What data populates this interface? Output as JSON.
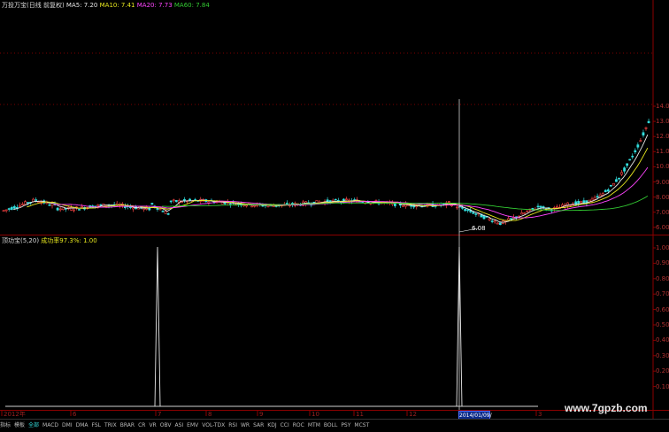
{
  "header": {
    "title": "万投万宝(日线 前复权)",
    "ma5": "MA5: 7.20",
    "ma10": "MA10: 7.41",
    "ma20": "MA20: 7.73",
    "ma60": "MA60: 7.84"
  },
  "indicator": {
    "title": "顶功宝(5,20)",
    "value": "成功率97.3%: 1.00"
  },
  "price_axis": [
    "14.00",
    "13.00",
    "12.00",
    "11.00",
    "10.00",
    "9.00",
    "8.00",
    "7.00",
    "6.00"
  ],
  "indicator_axis": [
    "1.00",
    "0.90",
    "0.80",
    "0.70",
    "0.60",
    "0.50",
    "0.40",
    "0.30",
    "0.20",
    "0.10"
  ],
  "low_marker": "6.08",
  "time_axis": [
    "2012年",
    "6",
    "7",
    "8",
    "9",
    "10",
    "11",
    "12",
    "3"
  ],
  "date_cursor": "2014/01/09/四",
  "bottom_tabs": [
    "指标",
    "模板",
    "全部",
    "MACD",
    "DMI",
    "DMA",
    "FSL",
    "TRIX",
    "BRAR",
    "CR",
    "VR",
    "OBV",
    "ASI",
    "EMV",
    "VOL-TDX",
    "RSI",
    "WR",
    "SAR",
    "KDJ",
    "CCI",
    "ROC",
    "MTM",
    "BOLL",
    "PSY",
    "MCST"
  ],
  "watermark": "www.7gpzb.com",
  "colors": {
    "up": "#ff4444",
    "down": "#33dddd",
    "ma5": "#e8e8e8",
    "ma10": "#e6e61e",
    "ma20": "#ff44ff",
    "ma60": "#33cc33",
    "grid": "#7a0000",
    "border": "#8b0000"
  }
}
